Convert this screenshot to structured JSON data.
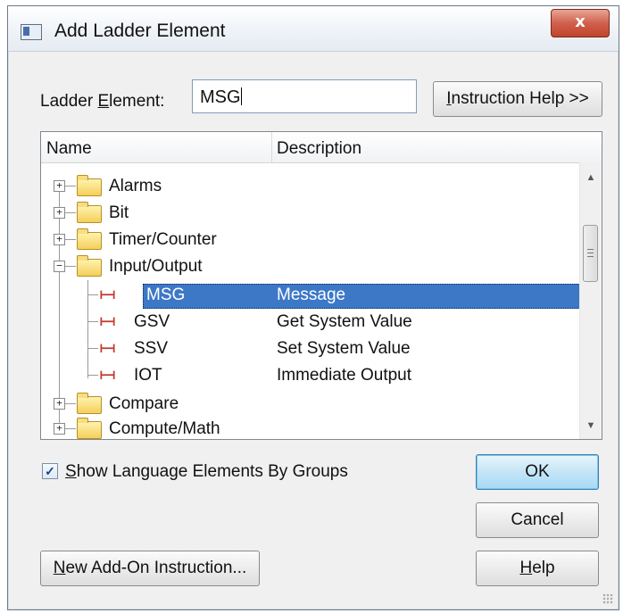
{
  "window": {
    "title": "Add Ladder Element",
    "close_glyph": "x",
    "icon": "app-window-icon"
  },
  "ladder_element": {
    "label_prefix": "Ladder ",
    "label_accel": "E",
    "label_suffix": "lement:",
    "value": "MSG"
  },
  "buttons": {
    "instruction_help_accel": "I",
    "instruction_help_rest": "nstruction Help >>",
    "ok": "OK",
    "cancel": "Cancel",
    "help_accel": "H",
    "help_rest": "elp",
    "new_addon_accel": "N",
    "new_addon_rest": "ew Add-On Instruction..."
  },
  "tree": {
    "columns": {
      "name": "Name",
      "description": "Description"
    },
    "groups": [
      {
        "label": "Alarms",
        "expander": "+"
      },
      {
        "label": "Bit",
        "expander": "+"
      },
      {
        "label": "Timer/Counter",
        "expander": "+"
      },
      {
        "label": "Input/Output",
        "expander": "−"
      },
      {
        "label": "Compare",
        "expander": "+"
      },
      {
        "label": "Compute/Math",
        "expander": "+"
      }
    ],
    "instructions": [
      {
        "name": "MSG",
        "description": "Message",
        "selected": true
      },
      {
        "name": "GSV",
        "description": "Get System Value"
      },
      {
        "name": "SSV",
        "description": "Set System Value"
      },
      {
        "name": "IOT",
        "description": "Immediate Output"
      }
    ],
    "rung_glyph": "⊢⊣"
  },
  "show_groups": {
    "checked": true,
    "glyph": "✓",
    "label_accel": "S",
    "label_rest": "how Language Elements By Groups"
  },
  "colors": {
    "selection": "#3d78c7",
    "close": "#c2432d",
    "rung": "#c0392b"
  }
}
